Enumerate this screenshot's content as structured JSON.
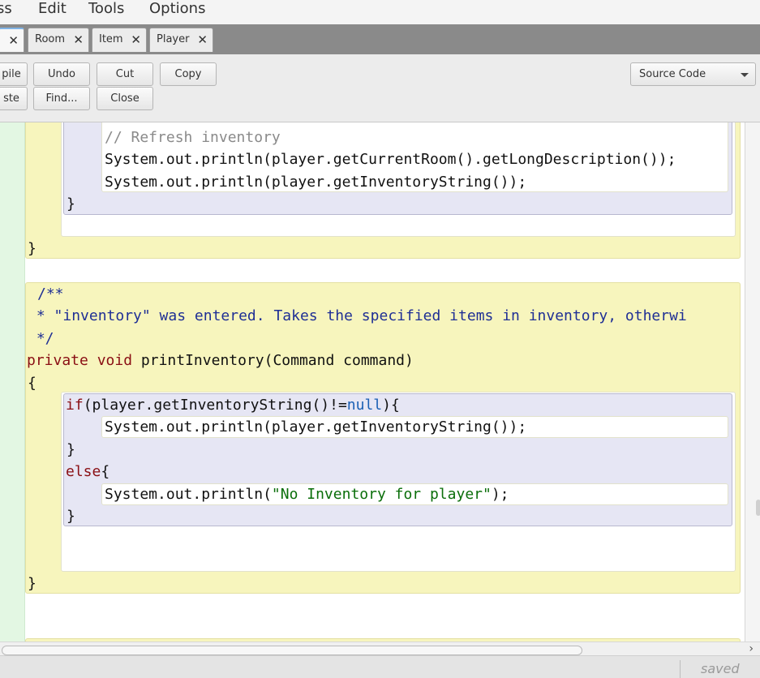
{
  "menu": [
    "ss",
    "Edit",
    "Tools",
    "Options"
  ],
  "tabs": [
    {
      "label": "",
      "close": "✕"
    },
    {
      "label": "Room",
      "close": "✕"
    },
    {
      "label": "Item",
      "close": "✕"
    },
    {
      "label": "Player",
      "close": "✕"
    }
  ],
  "toolbar": {
    "compile": "pile",
    "undo": "Undo",
    "cut": "Cut",
    "copy": "Copy",
    "paste": "ste",
    "find": "Find...",
    "close": "Close",
    "view_select": "Source Code"
  },
  "code": {
    "comment_refresh": "// Refresh inventory",
    "println_room": "System.out.println(player.getCurrentRoom().getLongDescription());",
    "println_inventory_1": "System.out.println(player.getInventoryString());",
    "brace_close": "}",
    "brace_open": "{",
    "doc_open": "/**",
    "doc_line_prefix": " * ",
    "doc_line_text": "\"inventory\" was entered. Takes the specified items in inventory, otherwi",
    "doc_close": " */",
    "method_mod_private": "private",
    "method_mod_void": "void",
    "method_sig_rest": "printInventory(Command command)",
    "if_kw": "if",
    "if_cond_a": "(player.getInventoryString()!=",
    "null_kw": "null",
    "if_cond_b": "){",
    "println_inventory_2": "System.out.println(player.getInventoryString());",
    "else_kw": "else",
    "else_rest": "{",
    "println_no_inv_a": "System.out.println(",
    "no_inv_string": "\"No Inventory for player\"",
    "println_no_inv_b": ");"
  },
  "status": {
    "saved": "saved"
  }
}
